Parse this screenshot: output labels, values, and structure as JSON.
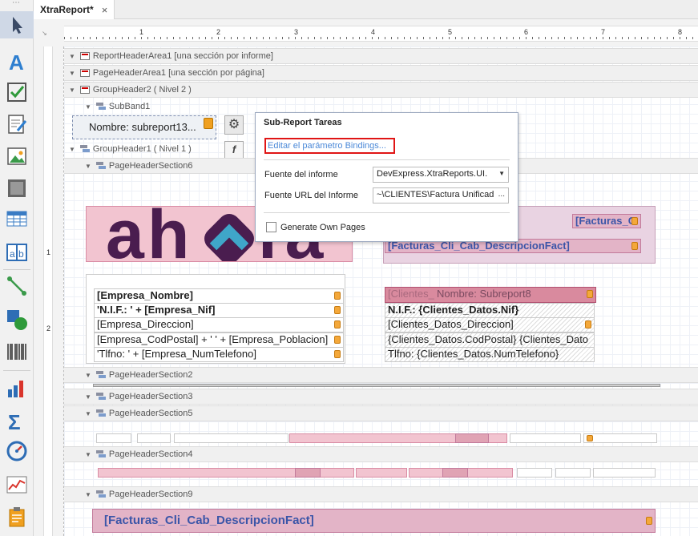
{
  "tab": {
    "title": "XtraReport*",
    "close": "×"
  },
  "ruler": {
    "numbers": [
      "1",
      "2",
      "3",
      "4",
      "5",
      "6",
      "7",
      "8"
    ],
    "vnumbers": [
      "1",
      "2"
    ]
  },
  "bands": {
    "report_header": "ReportHeaderArea1 [una sección por informe]",
    "page_header": "PageHeaderArea1 [una sección por página]",
    "group_header2": "GroupHeader2 ( Nivel 2 )",
    "subband": "SubBand1",
    "group_header1": "GroupHeader1 ( Nivel 1 )",
    "phs6": "PageHeaderSection6",
    "phs2": "PageHeaderSection2",
    "phs3": "PageHeaderSection3",
    "phs5": "PageHeaderSection5",
    "phs4": "PageHeaderSection4",
    "phs9": "PageHeaderSection9"
  },
  "subreport": {
    "label": "Nombre: subreport13..."
  },
  "popup": {
    "title": "Sub-Report Tareas",
    "link": "Editar el parámetro Bindings...",
    "source_label": "Fuente del informe",
    "source_value": "DevExpress.XtraReports.UI.",
    "url_label": "Fuente URL del Informe",
    "url_value": "~\\CLIENTES\\Factura Unificad",
    "url_button": "...",
    "check_label": "Generate Own Pages"
  },
  "company_fields": [
    "[Empresa_Nombre]",
    "'N.I.F.: ' + [Empresa_Nif]",
    "[Empresa_Direccion]",
    "[Empresa_CodPostal] + ' ' + [Empresa_Poblacion]",
    "'Tlfno: ' + [Empresa_NumTelefono]"
  ],
  "client_fields": {
    "subreport_name": "Nombre: Subreport8",
    "clientes_faded": "[Clientes_",
    "nif": "N.I.F.: {Clientes_Datos.Nif}",
    "direccion": "[Clientes_Datos_Direccion]",
    "cp": "{Clientes_Datos.CodPostal} {Clientes_Dato",
    "telefono": "Tlfno: {Clientes_Datos.NumTelefono}"
  },
  "header_fields": {
    "facturas_short": "[Facturas_C",
    "descripcion": "[Facturas_Cli_Cab_DescripcionFact]",
    "bottom_descripcion": "[Facturas_Cli_Cab_DescripcionFact]"
  },
  "logo_text": "ahora",
  "colors": {
    "logo_purple": "#4a1d4f",
    "logo_teal": "#3fa6c9",
    "highlight_red": "#e01515",
    "link_blue": "#4b89d8"
  }
}
